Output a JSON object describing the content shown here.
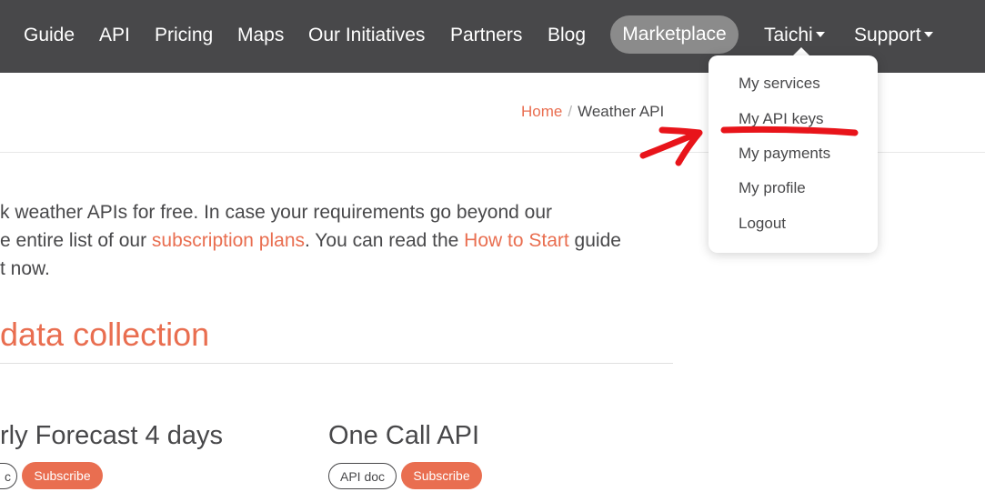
{
  "nav": {
    "items": [
      "Guide",
      "API",
      "Pricing",
      "Maps",
      "Our Initiatives",
      "Partners",
      "Blog"
    ],
    "marketplace": "Marketplace",
    "user": "Taichi",
    "support": "Support"
  },
  "user_menu": {
    "items": [
      "My services",
      "My API keys",
      "My payments",
      "My profile",
      "Logout"
    ]
  },
  "breadcrumb": {
    "home": "Home",
    "separator": "/",
    "current": "Weather API"
  },
  "intro": {
    "line1": "k weather APIs for free. In case your requirements go beyond our",
    "line2_pre": "e entire list of our ",
    "line2_link1": "subscription plans",
    "line2_mid": ". You can read the ",
    "line2_link2": "How to Start",
    "line2_post": " guide",
    "line3": "t now."
  },
  "section": {
    "title": "data collection"
  },
  "cards": [
    {
      "title": "rly Forecast 4 days",
      "doc_label": "c",
      "subscribe_label": "Subscribe"
    },
    {
      "title": "One Call API",
      "doc_label": "API doc",
      "subscribe_label": "Subscribe"
    }
  ],
  "colors": {
    "navbar": "#48484a",
    "accent": "#e96e50",
    "annotation": "#e8141a"
  }
}
